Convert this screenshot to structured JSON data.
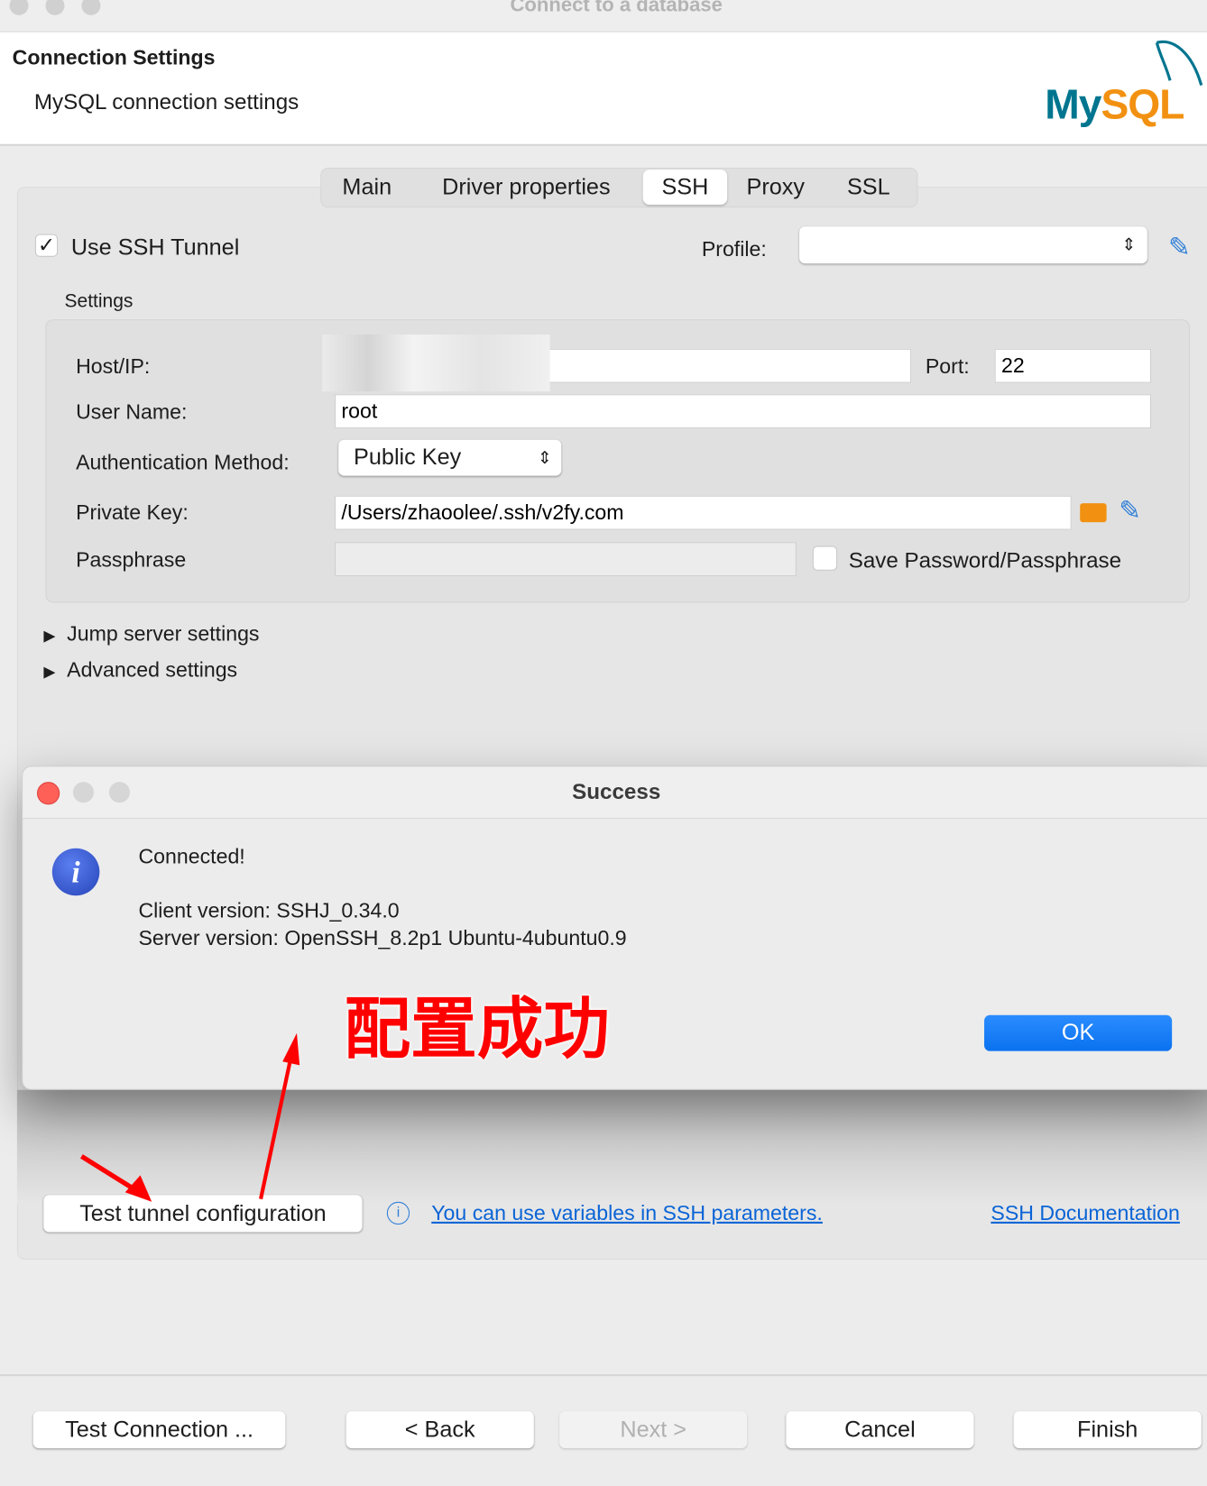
{
  "window": {
    "title": "Connect to a database"
  },
  "header": {
    "title": "Connection Settings",
    "subtitle": "MySQL connection settings",
    "logo_text": "MySQL"
  },
  "tabs": [
    {
      "label": "Main"
    },
    {
      "label": "Driver properties"
    },
    {
      "label": "SSH",
      "selected": true
    },
    {
      "label": "Proxy"
    },
    {
      "label": "SSL"
    }
  ],
  "ssh": {
    "use_tunnel_label": "Use SSH Tunnel",
    "use_tunnel_checked": true,
    "profile_label": "Profile:",
    "profile_value": "",
    "settings_label": "Settings",
    "host_label": "Host/IP:",
    "host_value": "",
    "port_label": "Port:",
    "port_value": "22",
    "user_label": "User Name:",
    "user_value": "root",
    "auth_label": "Authentication Method:",
    "auth_value": "Public Key",
    "key_label": "Private Key:",
    "key_value": "/Users/zhaoolee/.ssh/v2fy.com",
    "pass_label": "Passphrase",
    "pass_value": "",
    "save_pass_label": "Save Password/Passphrase",
    "save_pass_checked": false,
    "jump_label": "Jump server settings",
    "advanced_label": "Advanced settings",
    "test_tunnel_label": "Test tunnel configuration",
    "variables_link": "You can use variables in SSH parameters.",
    "doc_link": "SSH Documentation"
  },
  "dialog": {
    "title": "Success",
    "message": "Connected!",
    "client_version": "Client version: SSHJ_0.34.0",
    "server_version": "Server version: OpenSSH_8.2p1 Ubuntu-4ubuntu0.9",
    "ok_label": "OK"
  },
  "annotation": {
    "text": "配置成功",
    "color": "#ff0000"
  },
  "footer": {
    "test_connection": "Test Connection ...",
    "back": "< Back",
    "next": "Next >",
    "cancel": "Cancel",
    "finish": "Finish"
  },
  "colors": {
    "accent": "#0a7aff",
    "link": "#0a64d6",
    "mysql_teal": "#00758f",
    "mysql_orange": "#f29111"
  }
}
